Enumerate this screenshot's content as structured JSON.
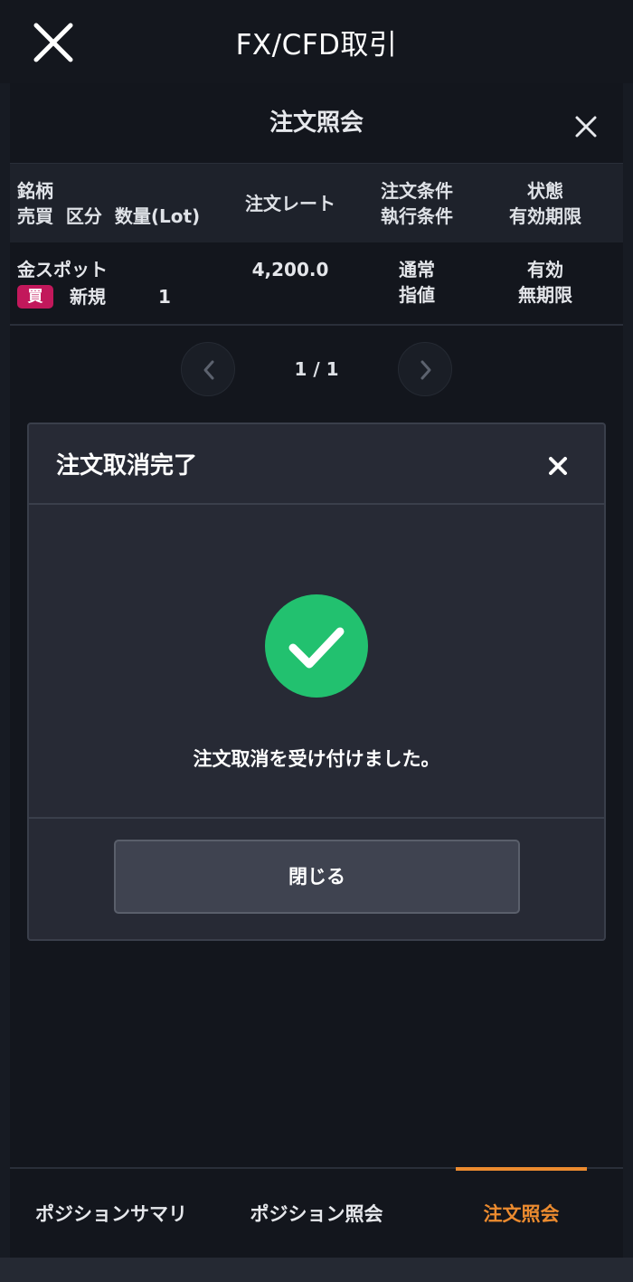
{
  "app": {
    "title": "FX/CFD取引",
    "close_icon": "close-icon"
  },
  "panel": {
    "title": "注文照会",
    "columns": {
      "symbol_label": "銘柄",
      "side_kind_qty_label": "売買  区分  数量(Lot)",
      "rate_label": "注文レート",
      "cond_label": "注文条件",
      "exec_label": "執行条件",
      "status_label": "状態",
      "expiry_label": "有効期限"
    },
    "orders": [
      {
        "symbol": "金スポット",
        "side": "買",
        "kind": "新規",
        "qty": "1",
        "rate": "4,200.0",
        "order_condition": "通常",
        "execution_condition": "指値",
        "status": "有効",
        "expiry": "無期限"
      }
    ],
    "pager": {
      "text": "1 / 1"
    }
  },
  "modal": {
    "title": "注文取消完了",
    "message": "注文取消を受け付けました。",
    "ok_label": "閉じる",
    "icon": "check-circle-icon"
  },
  "tabs": {
    "items": [
      {
        "label": "ポジションサマリ"
      },
      {
        "label": "ポジション照会"
      },
      {
        "label": "注文照会"
      }
    ],
    "active": "注文照会"
  },
  "colors": {
    "accent": "#ec8b2f",
    "success": "#22c16f",
    "buy_badge": "#c2185b",
    "modal_bg": "#272a35"
  }
}
